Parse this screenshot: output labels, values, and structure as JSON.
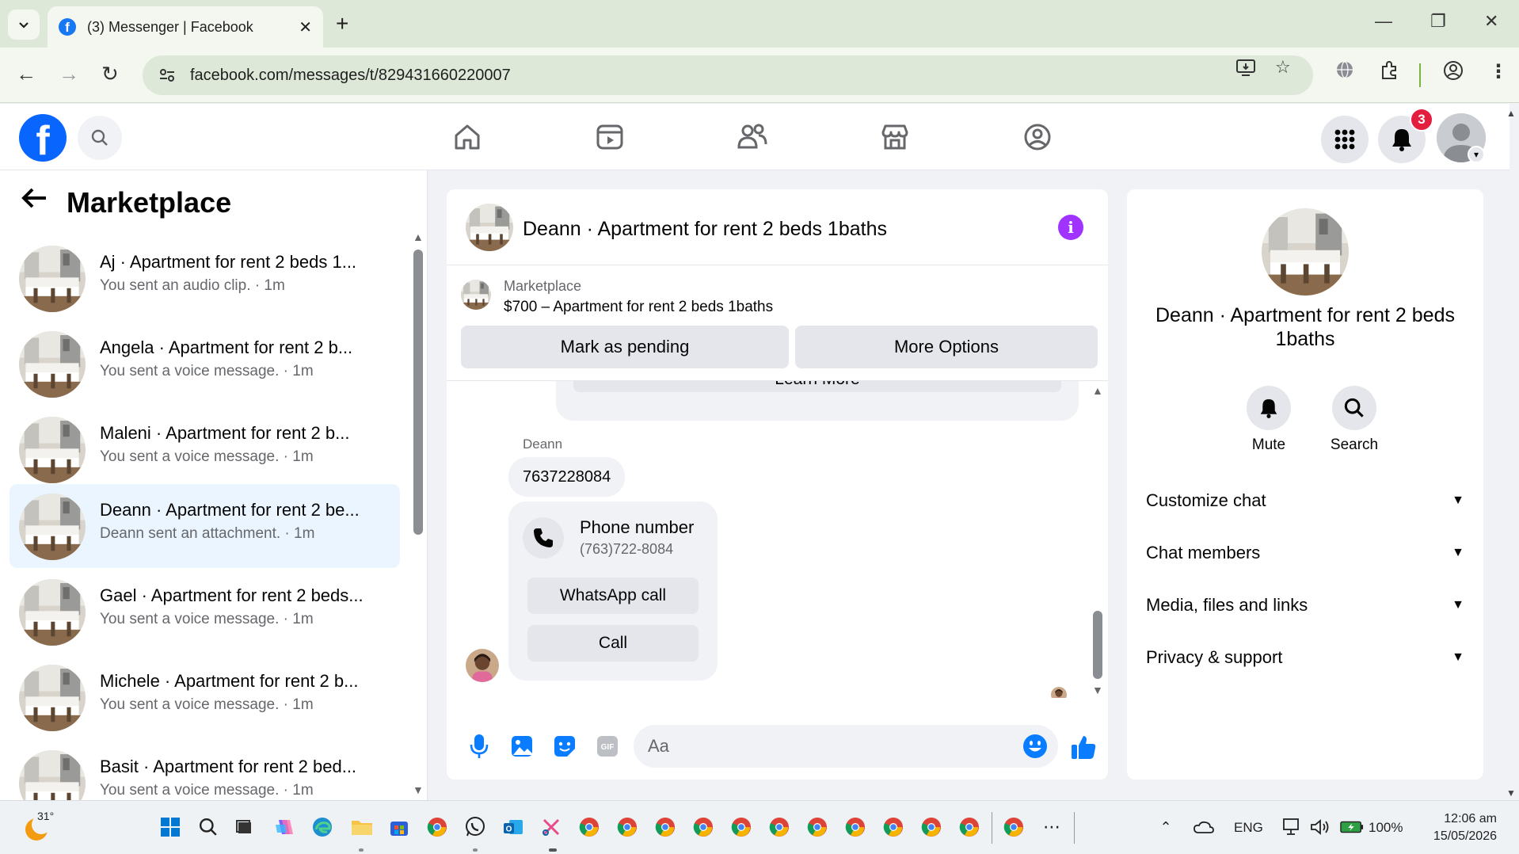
{
  "browser": {
    "tab_title": "(3) Messenger | Facebook",
    "url": "facebook.com/messages/t/829431660220007"
  },
  "facebook": {
    "notification_count": "3"
  },
  "sidebar": {
    "title": "Marketplace",
    "conversations": [
      {
        "name": "Aj · Apartment for rent 2 beds 1...",
        "preview": "You sent an audio clip. · 1m",
        "active": false
      },
      {
        "name": "Angela · Apartment for rent 2 b...",
        "preview": "You sent a voice message. · 1m",
        "active": false
      },
      {
        "name": "Maleni · Apartment for rent 2 b...",
        "preview": "You sent a voice message. · 1m",
        "active": false
      },
      {
        "name": "Deann · Apartment for rent 2 be...",
        "preview": "Deann sent an attachment. · 1m",
        "active": true
      },
      {
        "name": "Gael · Apartment for rent 2 beds...",
        "preview": "You sent a voice message. · 1m",
        "active": false
      },
      {
        "name": "Michele · Apartment for rent 2 b...",
        "preview": "You sent a voice message. · 1m",
        "active": false
      },
      {
        "name": "Basit · Apartment for rent 2 bed...",
        "preview": "You sent a voice message. · 1m",
        "active": false
      }
    ]
  },
  "chat": {
    "title": "Deann · Apartment for rent 2 beds 1baths",
    "marketplace_label": "Marketplace",
    "listing": "$700 – Apartment for rent 2 beds 1baths",
    "mark_pending": "Mark as pending",
    "more_options": "More Options",
    "learn_more": "Learn More",
    "sender": "Deann",
    "message": "7637228084",
    "phone_card": {
      "title": "Phone number",
      "number": "(763)722-8084",
      "whatsapp": "WhatsApp call",
      "call": "Call"
    },
    "composer_placeholder": "Aa"
  },
  "info_panel": {
    "name": "Deann · Apartment for rent 2 beds 1baths",
    "mute": "Mute",
    "search": "Search",
    "rows": [
      "Customize chat",
      "Chat members",
      "Media, files and links",
      "Privacy & support"
    ]
  },
  "taskbar": {
    "temperature": "31°",
    "language": "ENG",
    "battery": "100%",
    "time": "12:06 am",
    "date": "15/05/2026"
  },
  "colors": {
    "brand": "#0866ff",
    "accent_purple": "#a033ff",
    "messenger_blue": "#0a7cff",
    "active_row": "#ebf5ff",
    "badge_red": "#e41e3f"
  }
}
